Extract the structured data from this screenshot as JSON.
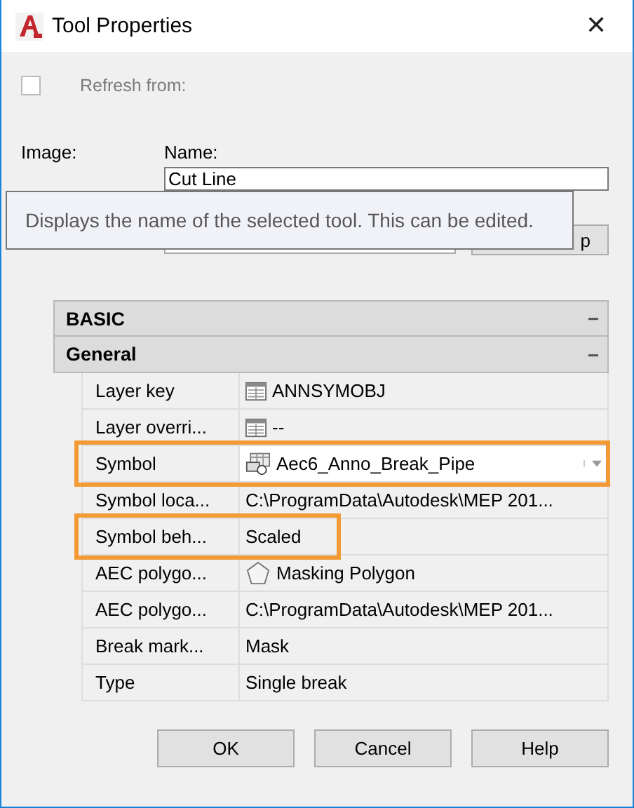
{
  "window": {
    "title": "Tool Properties",
    "close": "✕"
  },
  "refresh": {
    "label": "Refresh from:",
    "checked": false,
    "disabled": true
  },
  "image_label": "Image:",
  "name": {
    "label": "Name:",
    "value": "Cut Line"
  },
  "hidden_button": "p",
  "tooltip": "Displays the name of the selected tool. This can be edited.",
  "sections": [
    {
      "title": "BASIC",
      "toggle": "−"
    },
    {
      "title": "General",
      "toggle": "−"
    }
  ],
  "rows": [
    {
      "label": "Layer key",
      "value": "ANNSYMOBJ",
      "kind": "layer",
      "highlighted": false
    },
    {
      "label": "Layer overri...",
      "value": "--",
      "kind": "layer",
      "highlighted": false
    },
    {
      "label": "Symbol",
      "value": "Aec6_Anno_Break_Pipe",
      "kind": "dropdown",
      "highlighted": true
    },
    {
      "label": "Symbol loca...",
      "value": "C:\\ProgramData\\Autodesk\\MEP  201...",
      "kind": "text",
      "highlighted": false
    },
    {
      "label": "Symbol beh...",
      "value": "Scaled",
      "kind": "text",
      "highlighted": true
    },
    {
      "label": "AEC polygo...",
      "value": "Masking Polygon",
      "kind": "polygon",
      "highlighted": false
    },
    {
      "label": "AEC polygo...",
      "value": "C:\\ProgramData\\Autodesk\\MEP  201...",
      "kind": "text",
      "highlighted": false
    },
    {
      "label": "Break mark...",
      "value": "Mask",
      "kind": "text",
      "highlighted": false
    },
    {
      "label": "Type",
      "value": "Single break",
      "kind": "text",
      "highlighted": false
    }
  ],
  "buttons": [
    "OK",
    "Cancel",
    "Help"
  ]
}
